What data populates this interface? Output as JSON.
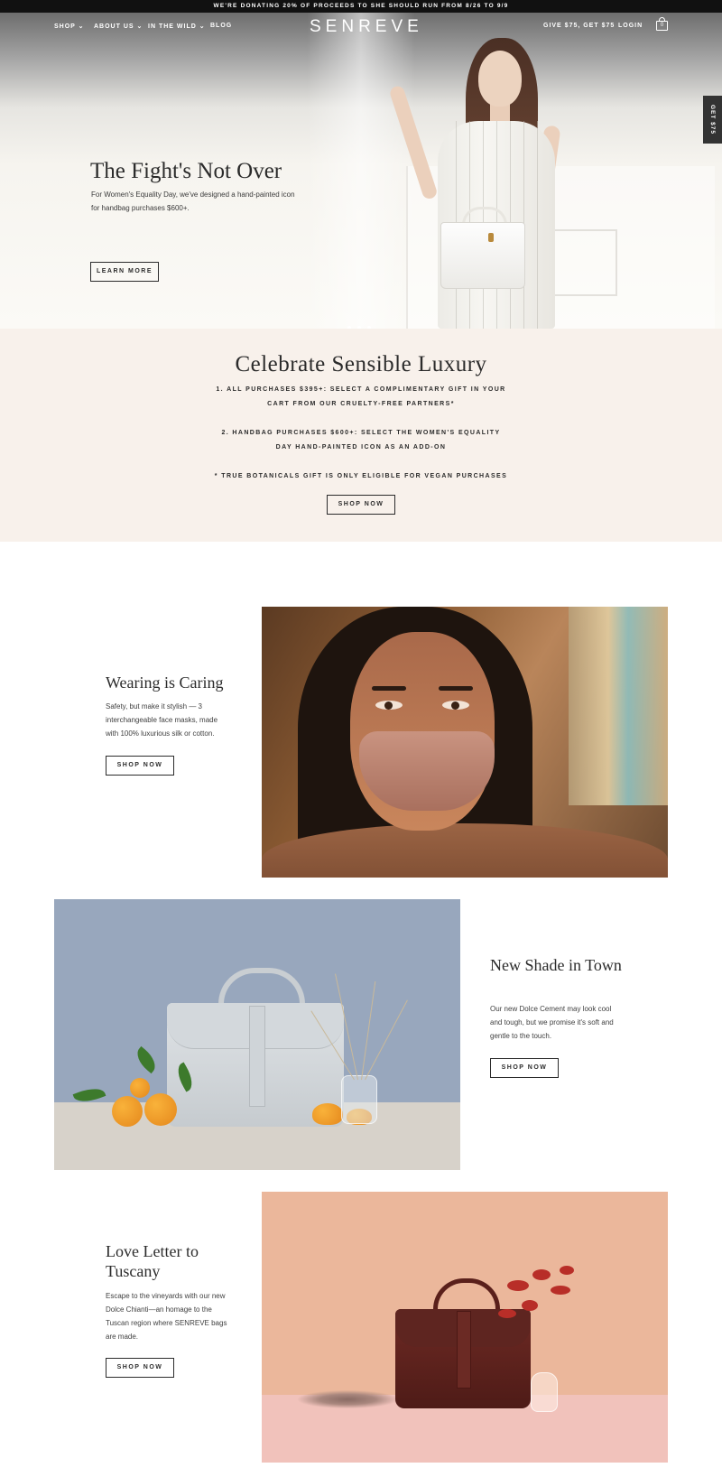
{
  "banner": {
    "text": "WE'RE DONATING 20% OF PROCEEDS TO SHE SHOULD RUN FROM 8/26 TO 9/9"
  },
  "nav": {
    "shop": "SHOP",
    "about": "ABOUT US",
    "wild": "IN THE WILD",
    "blog": "BLOG",
    "logo": "SENREVE",
    "give": "GIVE $75, GET $75",
    "login": "LOGIN",
    "cart_count": "0",
    "side_tab": "GET $75"
  },
  "hero": {
    "title": "The Fight's Not Over",
    "text": "For Women's Equality Day, we've designed a hand-painted icon for handbag purchases $600+.",
    "button": "LEARN MORE"
  },
  "promo": {
    "title": "Celebrate Sensible Luxury",
    "line1a": "1. ALL PURCHASES $395+: SELECT A COMPLIMENTARY GIFT IN YOUR",
    "line1b": "CART FROM OUR CRUELTY-FREE PARTNERS*",
    "line2a": "2. HANDBAG PURCHASES $600+: SELECT THE WOMEN'S EQUALITY",
    "line2b": "DAY HAND-PAINTED ICON AS AN ADD-ON",
    "note": "* TRUE BOTANICALS GIFT IS ONLY ELIGIBLE FOR VEGAN PURCHASES",
    "button": "SHOP NOW"
  },
  "features": [
    {
      "title": "Wearing is Caring",
      "text": "Safety, but make it stylish — 3 interchangeable face masks, made with 100% luxurious silk or cotton.",
      "button": "SHOP NOW"
    },
    {
      "title": "New Shade in Town",
      "text": "Our new Dolce Cement may look cool and tough, but we promise it's soft and gentle to the touch.",
      "button": "SHOP NOW"
    },
    {
      "title": "Love Letter to Tuscany",
      "text": "Escape to the vineyards with our new Dolce Chianti—an homage to the Tuscan region where SENREVE bags are made.",
      "button": "SHOP NOW"
    }
  ],
  "colors": {
    "promo_bg": "#f8f1eb",
    "banner_bg": "#111111",
    "text": "#2b2b2b"
  },
  "icons": {
    "cart": "shopping-bag-icon",
    "chevron": "chevron-down-icon"
  }
}
